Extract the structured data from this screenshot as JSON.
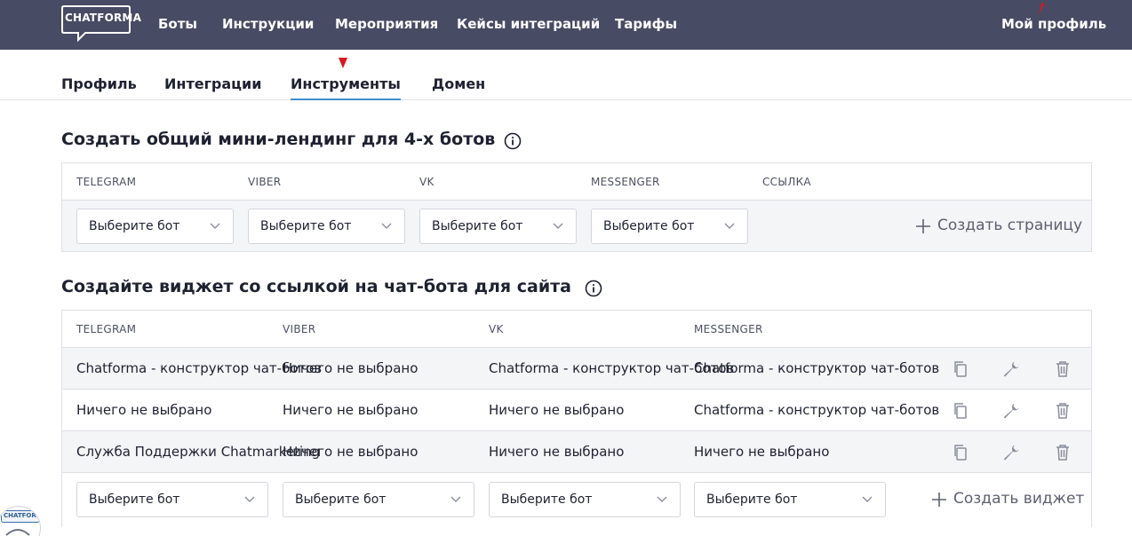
{
  "header": {
    "logo_text": "CHATFORMA",
    "nav": [
      "Боты",
      "Инструкции",
      "Мероприятия",
      "Кейсы интеграций",
      "Тарифы"
    ],
    "profile_link": "Мой профиль"
  },
  "tabs": [
    "Профиль",
    "Интеграции",
    "Инструменты",
    "Домен"
  ],
  "active_tab": "Инструменты",
  "landing": {
    "title": "Создать общий мини-лендинг для 4-х ботов",
    "columns": [
      "TELEGRAM",
      "VIBER",
      "VK",
      "MESSENGER",
      "ССЫЛКА"
    ],
    "select_placeholder": "Выберите бот",
    "create_label": "Создать страницу"
  },
  "widget": {
    "title": "Создайте виджет со ссылкой на чат-бота для сайта",
    "columns": [
      "TELEGRAM",
      "VIBER",
      "VK",
      "MESSENGER"
    ],
    "rows": [
      [
        "Chatforma - конструктор чат-ботов",
        "Ничего не выбрано",
        "Chatforma - конструктор чат-ботов",
        "Chatforma - конструктор чат-ботов"
      ],
      [
        "Ничего не выбрано",
        "Ничего не выбрано",
        "Ничего не выбрано",
        "Chatforma - конструктор чат-ботов"
      ],
      [
        "Служба Поддержки Chatmarketing",
        "Ничего не выбрано",
        "Ничего не выбрано",
        "Ничего не выбрано"
      ]
    ],
    "select_placeholder": "Выберите бот",
    "create_label": "Создать виджет"
  },
  "launcher": {
    "logo_text": "CHATFORMA"
  },
  "colors": {
    "header_bg": "#474b63",
    "active_tab_underline": "#3f8fd0",
    "alt_row_bg": "#f4f5f7",
    "cursor_marker": "#e0141e"
  },
  "icons": [
    "info-icon",
    "chevron-down-icon",
    "plus-icon",
    "copy-icon",
    "wrench-icon",
    "trash-icon"
  ]
}
